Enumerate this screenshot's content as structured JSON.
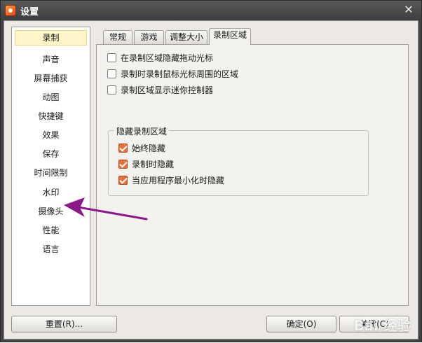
{
  "window": {
    "title": "设置",
    "close_glyph": "✕"
  },
  "sidebar": {
    "items": [
      {
        "label": "录制",
        "active": true
      },
      {
        "label": "声音"
      },
      {
        "label": "屏幕捕获"
      },
      {
        "label": "动图"
      },
      {
        "label": "快捷键"
      },
      {
        "label": "效果"
      },
      {
        "label": "保存"
      },
      {
        "label": "时间限制"
      },
      {
        "label": "水印"
      },
      {
        "label": "摄像头"
      },
      {
        "label": "性能"
      },
      {
        "label": "语言"
      }
    ]
  },
  "tabs": [
    {
      "label": "常规"
    },
    {
      "label": "游戏"
    },
    {
      "label": "调整大小"
    },
    {
      "label": "录制区域",
      "active": true
    }
  ],
  "options": [
    {
      "label": "在录制区域隐藏拖动光标",
      "checked": false
    },
    {
      "label": "录制时录制鼠标光标周围的区域",
      "checked": false
    },
    {
      "label": "录制区域显示迷你控制器",
      "checked": false
    }
  ],
  "hide_group": {
    "title": "隐藏录制区域",
    "options": [
      {
        "label": "始终隐藏",
        "checked": true
      },
      {
        "label": "录制时隐藏",
        "checked": true
      },
      {
        "label": "当应用程序最小化时隐藏",
        "checked": true
      }
    ]
  },
  "buttons": {
    "reset": "重置(R)...",
    "ok": "确定(O)",
    "close": "关闭(C)"
  },
  "watermark": "Bai 经验",
  "colors": {
    "checkbox_checked": "#e56f3d",
    "active_item": "#fff5c8",
    "annotation_arrow": "#8a1a8a"
  }
}
